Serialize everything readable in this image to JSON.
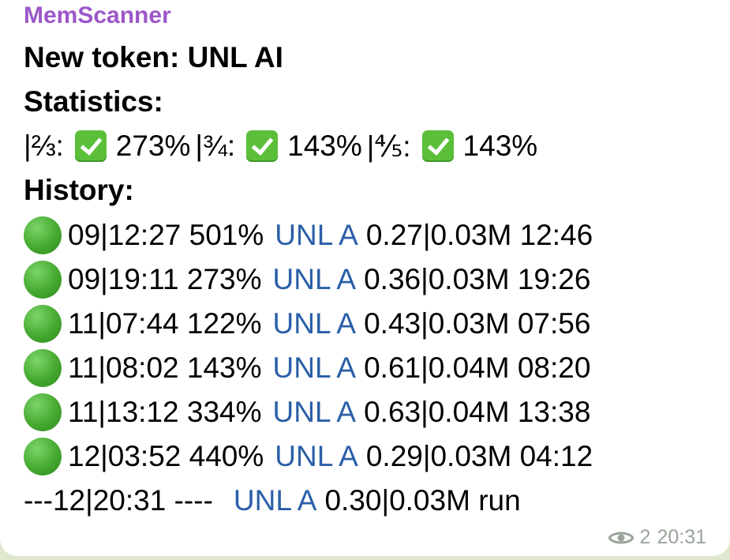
{
  "message": {
    "sender": "MemScanner",
    "token_line": "New token: UNL AI",
    "statistics_heading": "Statistics:",
    "stats": [
      {
        "label": "|⅔:",
        "value": "273%"
      },
      {
        "label": "|¾:",
        "value": "143%"
      },
      {
        "label": "|⅘:",
        "value": "143%"
      }
    ],
    "history_heading": "History:",
    "history": [
      {
        "time": "09|12:27 501%",
        "link": "UNL A",
        "tail": "0.27|0.03M 12:46"
      },
      {
        "time": "09|19:11 273%",
        "link": "UNL A",
        "tail": "0.36|0.03M 19:26"
      },
      {
        "time": "11|07:44 122%",
        "link": "UNL A",
        "tail": "0.43|0.03M 07:56"
      },
      {
        "time": "11|08:02 143%",
        "link": "UNL A",
        "tail": "0.61|0.04M 08:20"
      },
      {
        "time": "11|13:12 334%",
        "link": "UNL A",
        "tail": "0.63|0.04M 13:38"
      },
      {
        "time": "12|03:52 440%",
        "link": "UNL A",
        "tail": "0.29|0.03M 04:12"
      }
    ],
    "current": {
      "prefix": "---12|20:31 ----",
      "link": "UNL A",
      "tail": "0.30|0.03M run"
    },
    "views": "2",
    "timestamp": "20:31"
  },
  "icons": {
    "check": "check-mark-button-icon",
    "dot": "green-circle-icon",
    "views": "eye-icon"
  },
  "colors": {
    "sender": "#9b57c9",
    "link": "#2a5fa8",
    "meta": "#9aa49a",
    "check": "#5cbf3a",
    "dot": "#45a92f"
  }
}
